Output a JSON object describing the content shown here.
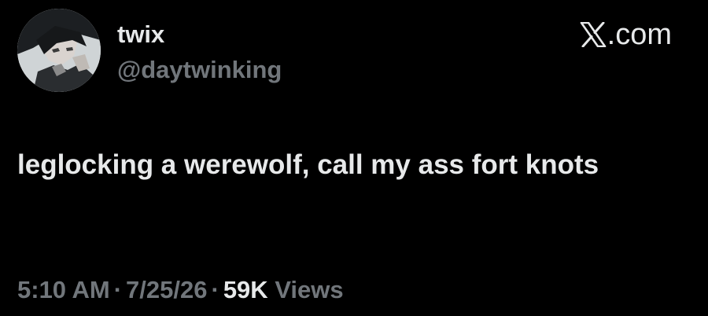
{
  "user": {
    "display_name": "twix",
    "handle": "@daytwinking",
    "avatar_icon": "anime-character-avatar"
  },
  "source": {
    "icon": "x-logo-icon",
    "label": ".com"
  },
  "tweet": {
    "text": "leglocking a werewolf, call my ass fort knots"
  },
  "meta": {
    "time": "5:10 AM",
    "separator": "·",
    "date": "7/25/26",
    "views_count": "59K",
    "views_label": "Views"
  },
  "colors": {
    "background": "#000000",
    "primary_text": "#e7e9ea",
    "secondary_text": "#71767b"
  }
}
